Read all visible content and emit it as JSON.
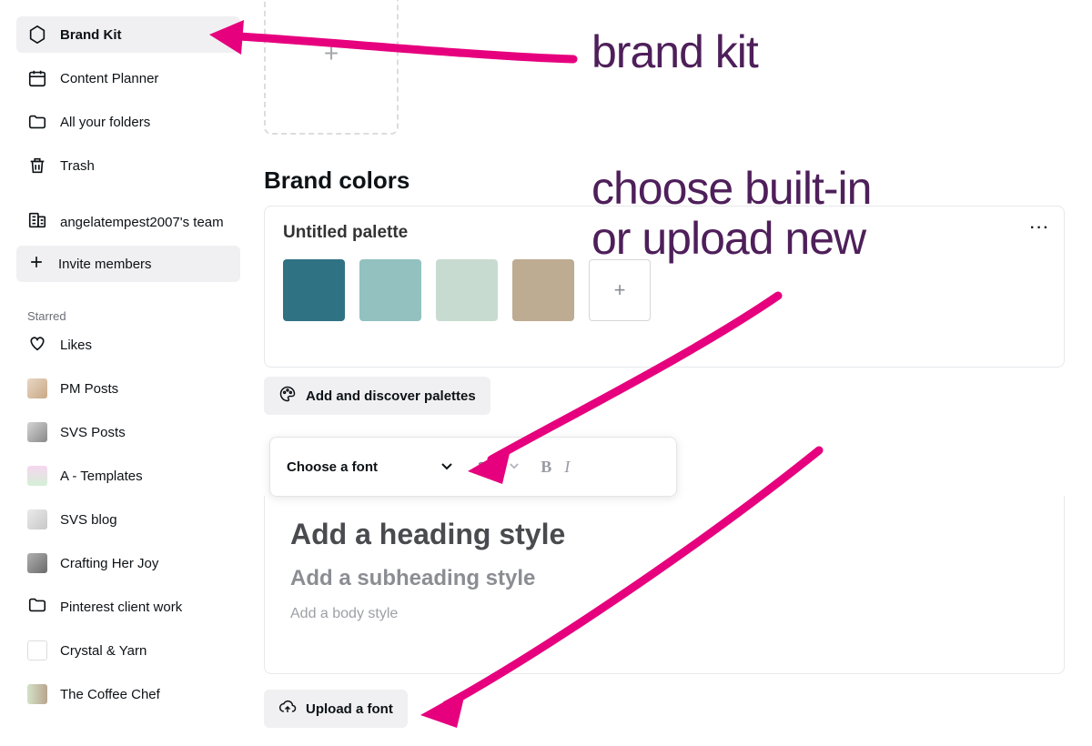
{
  "sidebar": {
    "items": [
      {
        "label": "Brand Kit"
      },
      {
        "label": "Content Planner"
      },
      {
        "label": "All your folders"
      },
      {
        "label": "Trash"
      }
    ],
    "team_label": "angelatempest2007's team",
    "invite_label": "Invite members",
    "starred_heading": "Starred",
    "likes_label": "Likes",
    "starred": [
      {
        "label": "PM Posts"
      },
      {
        "label": "SVS Posts"
      },
      {
        "label": "A - Templates"
      },
      {
        "label": "SVS blog"
      },
      {
        "label": "Crafting Her Joy"
      },
      {
        "label": "Pinterest client work"
      },
      {
        "label": "Crystal & Yarn"
      },
      {
        "label": "The Coffee Chef"
      }
    ]
  },
  "brand_colors": {
    "title": "Brand colors",
    "palette_title": "Untitled palette",
    "more": "···",
    "swatches": [
      "#2f7284",
      "#92c1c0",
      "#c8dbd0",
      "#bdab92"
    ],
    "discover_label": "Add and discover palettes"
  },
  "font_bar": {
    "choose_label": "Choose a font",
    "size": "31.5",
    "bold": "B",
    "italic": "I"
  },
  "styles": {
    "heading": "Add a heading style",
    "subheading": "Add a subheading style",
    "body": "Add a body style"
  },
  "upload_label": "Upload a font",
  "annotations": {
    "a1": "brand kit",
    "a2_line1": "choose built-in",
    "a2_line2": "or upload new"
  },
  "glyphs": {
    "plus": "+",
    "chev_down": "⌄"
  }
}
